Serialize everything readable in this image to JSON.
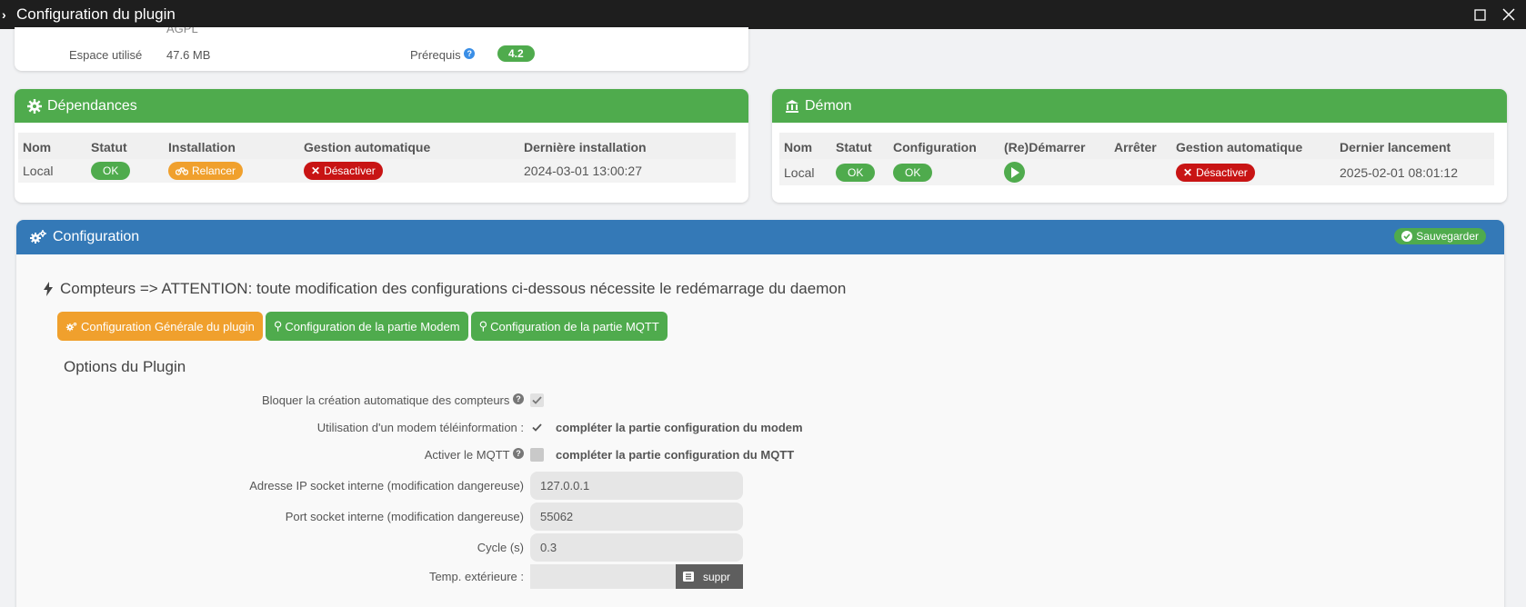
{
  "titlebar": {
    "title": "Configuration du plugin"
  },
  "info": {
    "cut_text": "AGPL",
    "space_label": "Espace utilisé",
    "space_value": "47.6 MB",
    "prereq_label": "Prérequis",
    "prereq_value": "4.2"
  },
  "dependances": {
    "title": "Dépendances",
    "headers": [
      "Nom",
      "Statut",
      "Installation",
      "Gestion automatique",
      "Dernière installation"
    ],
    "row": {
      "nom": "Local",
      "statut": "OK",
      "installation": "Relancer",
      "gestion": "Désactiver",
      "derniere": "2024-03-01 13:00:27"
    }
  },
  "demon": {
    "title": "Démon",
    "headers": [
      "Nom",
      "Statut",
      "Configuration",
      "(Re)Démarrer",
      "Arrêter",
      "Gestion automatique",
      "Dernier lancement"
    ],
    "row": {
      "nom": "Local",
      "statut": "OK",
      "configuration": "OK",
      "gestion": "Désactiver",
      "dernier": "2025-02-01 08:01:12"
    }
  },
  "config": {
    "title": "Configuration",
    "save_label": "Sauvegarder",
    "warning": "Compteurs => ATTENTION: toute modification des configurations ci-dessous nécessite le redémarrage du daemon",
    "tabs": [
      "Configuration Générale du plugin",
      "Configuration de la partie Modem",
      "Configuration de la partie MQTT"
    ],
    "section_title": "Options du Plugin",
    "fields": {
      "block_label": "Bloquer la création automatique des compteurs",
      "modem_label": "Utilisation d'un modem téléinformation :",
      "modem_note": "compléter la partie configuration du modem",
      "mqtt_label": "Activer le MQTT",
      "mqtt_note": "compléter la partie configuration du MQTT",
      "ip_label": "Adresse IP socket interne (modification dangereuse)",
      "ip_value": "127.0.0.1",
      "port_label": "Port socket interne (modification dangereuse)",
      "port_value": "55062",
      "cycle_label": "Cycle (s)",
      "cycle_value": "0.3",
      "temp_label": "Temp. extérieure :",
      "temp_value": "",
      "suppr_label": "suppr"
    }
  }
}
